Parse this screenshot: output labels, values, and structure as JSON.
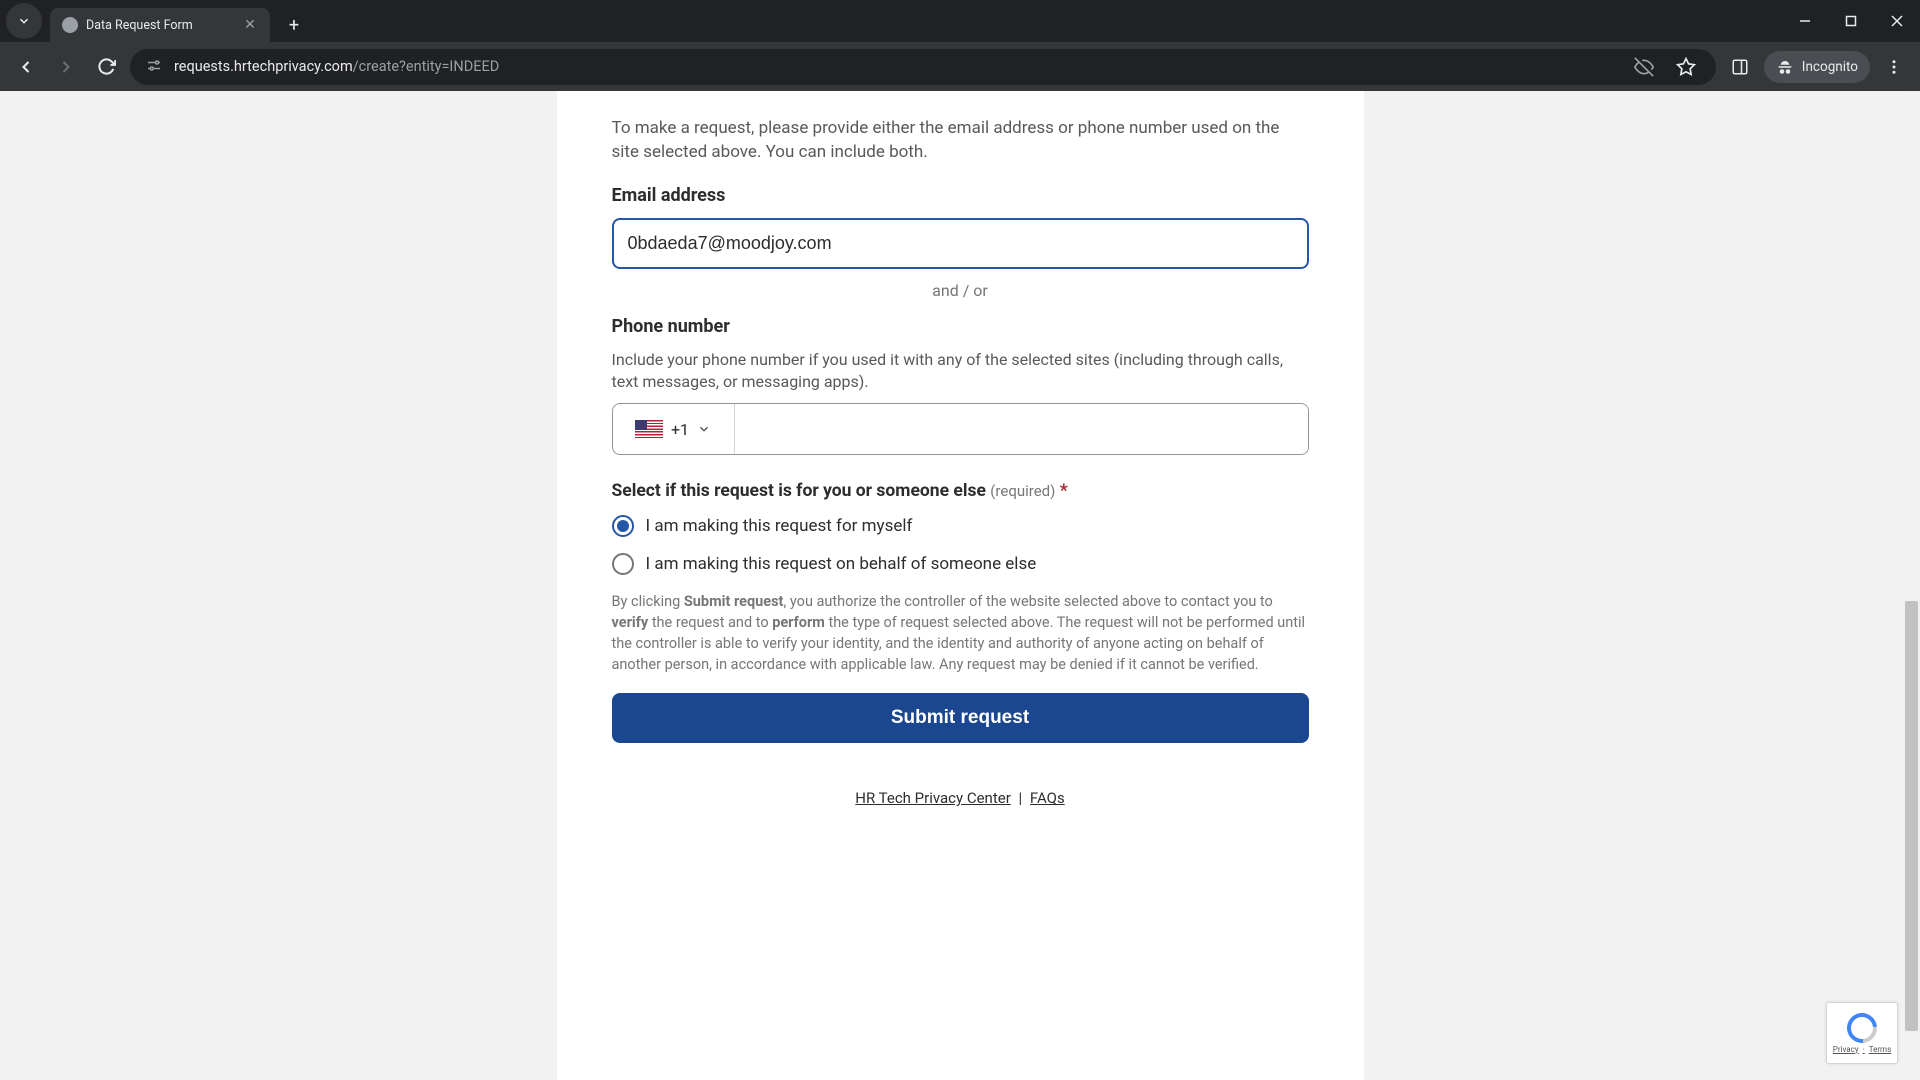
{
  "browser": {
    "tab_title": "Data Request Form",
    "url_domain": "requests.hrtechprivacy.com",
    "url_path": "/create?entity=INDEED",
    "incognito_label": "Incognito"
  },
  "form": {
    "intro": "To make a request, please provide either the email address or phone number used on the site selected above. You can include both.",
    "email_label": "Email address",
    "email_value": "0bdaeda7@moodjoy.com",
    "andor": "and / or",
    "phone_label": "Phone number",
    "phone_hint": "Include your phone number if you used it with any of the selected sites (including through calls, text messages, or messaging apps).",
    "dial_code": "+1",
    "requester_heading": "Select if this request is for you or someone else",
    "required_tag": "(required)",
    "required_star": "*",
    "radio1": "I am making this request for myself",
    "radio2": "I am making this request on behalf of someone else",
    "disclaimer_1": "By clicking ",
    "disclaimer_b1": "Submit request",
    "disclaimer_2": ", you authorize the controller of the website selected above to contact you to ",
    "disclaimer_b2": "verify",
    "disclaimer_3": " the request and to ",
    "disclaimer_b3": "perform",
    "disclaimer_4": " the type of request selected above. The request will not be performed until the controller is able to verify your identity, and the identity and authority of anyone acting on behalf of another person, in accordance with applicable law. Any request may be denied if it cannot be verified.",
    "submit_label": "Submit request"
  },
  "footer": {
    "link1": "HR Tech Privacy Center",
    "sep": "|",
    "link2": "FAQs"
  },
  "recaptcha": {
    "privacy": "Privacy",
    "terms": "Terms"
  }
}
